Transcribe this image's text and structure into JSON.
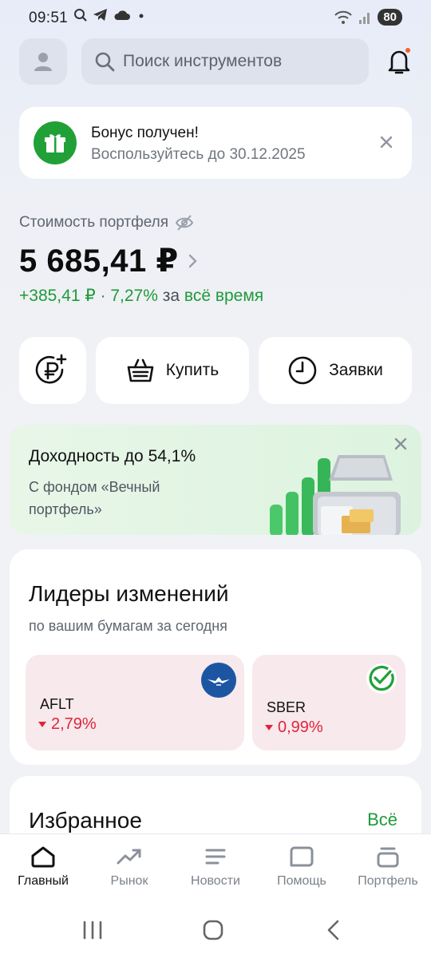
{
  "status": {
    "time": "09:51",
    "battery": "80"
  },
  "search": {
    "placeholder": "Поиск инструментов"
  },
  "bonus": {
    "title": "Бонус получен!",
    "subtitle": "Воспользуйтесь до 30.12.2025"
  },
  "portfolio": {
    "label": "Стоимость портфеля",
    "value": "5 685,41 ₽",
    "change_value": "+385,41 ₽ · 7,27%",
    "change_mid": "за",
    "change_period": "всё время"
  },
  "actions": {
    "buy_label": "Купить",
    "orders_label": "Заявки"
  },
  "promo": {
    "title": "Доходность до 54,1%",
    "subtitle": "С фондом «Вечный портфель»"
  },
  "leaders": {
    "title": "Лидеры изменений",
    "subtitle": "по вашим бумагам за сегодня",
    "items": [
      {
        "ticker": "AFLT",
        "change": "2,79%",
        "direction": "down"
      },
      {
        "ticker": "SBER",
        "change": "0,99%",
        "direction": "down"
      }
    ]
  },
  "favorites": {
    "title": "Избранное",
    "all_link": "Всё"
  },
  "nav": {
    "items": [
      {
        "label": "Главный",
        "icon": "home-icon",
        "active": true
      },
      {
        "label": "Рынок",
        "icon": "trend-icon",
        "active": false
      },
      {
        "label": "Новости",
        "icon": "news-icon",
        "active": false
      },
      {
        "label": "Помощь",
        "icon": "chat-icon",
        "active": false
      },
      {
        "label": "Портфель",
        "icon": "wallet-icon",
        "active": false
      }
    ]
  },
  "colors": {
    "accent_green": "#21a038",
    "negative_red": "#e0243c",
    "notification_dot": "#f0602a"
  }
}
